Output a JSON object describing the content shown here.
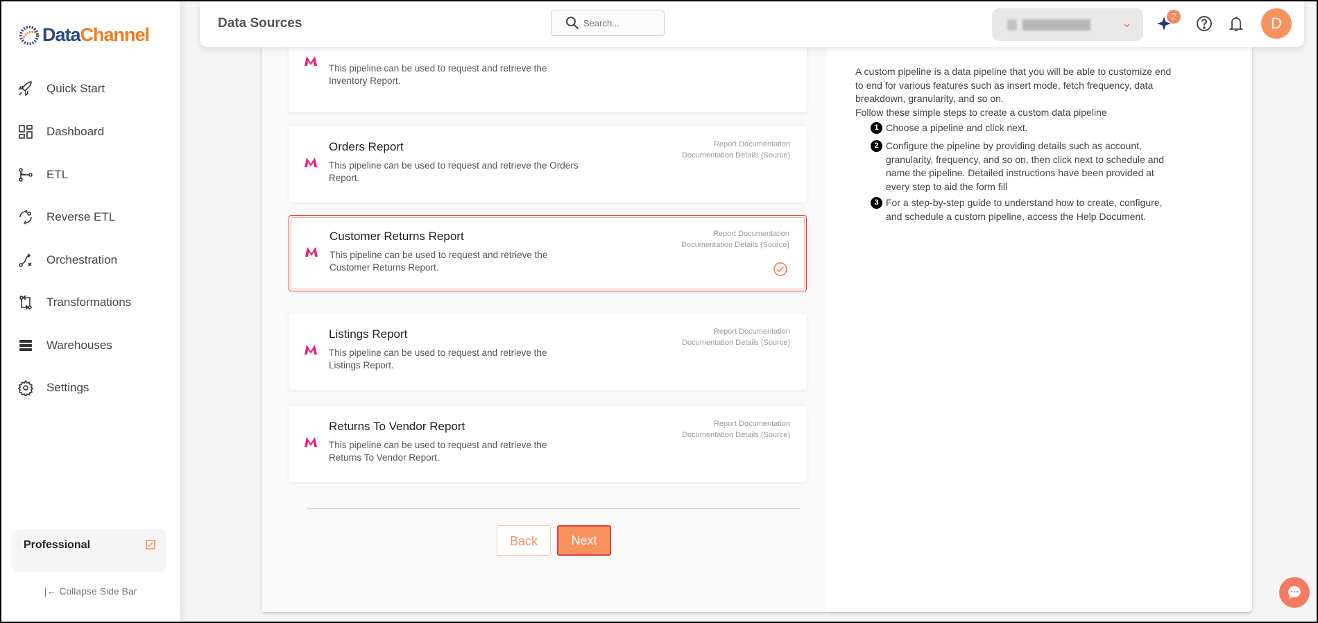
{
  "brand": {
    "name_part1": "Data",
    "name_part2": "Channel",
    "colors": {
      "blue": "#2a4a7f",
      "orange": "#f47c20"
    }
  },
  "sidebar": {
    "items": [
      {
        "label": "Quick Start",
        "icon": "rocket-icon"
      },
      {
        "label": "Dashboard",
        "icon": "dashboard-icon"
      },
      {
        "label": "ETL",
        "icon": "etl-icon"
      },
      {
        "label": "Reverse ETL",
        "icon": "reverse-etl-icon"
      },
      {
        "label": "Orchestration",
        "icon": "orchestration-icon"
      },
      {
        "label": "Transformations",
        "icon": "transformations-icon"
      },
      {
        "label": "Warehouses",
        "icon": "warehouses-icon"
      },
      {
        "label": "Settings",
        "icon": "gear-icon"
      }
    ],
    "plan": "Professional",
    "collapse": "Collapse Side Bar"
  },
  "header": {
    "title": "Data Sources",
    "search_placeholder": "Search...",
    "notification_count": "2",
    "avatar_initial": "D"
  },
  "cards": [
    {
      "title": "",
      "description": "This pipeline can be used to request and retrieve the Inventory Report.",
      "selected": false
    },
    {
      "title": "Orders Report",
      "description": "This pipeline can be used to request and retrieve the Orders Report.",
      "doc1": "Report Documentation",
      "doc2": "Documentation Details (Source)",
      "selected": false
    },
    {
      "title": "Customer Returns Report",
      "description": "This pipeline can be used to request and retrieve the Customer Returns Report.",
      "doc1": "Report Documentation",
      "doc2": "Documentation Details (Source)",
      "selected": true
    },
    {
      "title": "Listings Report",
      "description": "This pipeline can be used to request and retrieve the Listings Report.",
      "doc1": "Report Documentation",
      "doc2": "Documentation Details (Source)",
      "selected": false
    },
    {
      "title": "Returns To Vendor Report",
      "description": "This pipeline can be used to request and retrieve the Returns To Vendor Report.",
      "doc1": "Report Documentation",
      "doc2": "Documentation Details (Source)",
      "selected": false
    }
  ],
  "buttons": {
    "back": "Back",
    "next": "Next"
  },
  "info": {
    "intro": "A custom pipeline is a data pipeline that you will be able to customize end to end for various features such as insert mode, fetch frequency, data breakdown, granularity, and so on.",
    "follow": "Follow these simple steps to create a custom data pipeline",
    "steps": [
      {
        "num": "1",
        "text": "Choose a pipeline and click next."
      },
      {
        "num": "2",
        "text": "Configure the pipeline by providing details such as account, granularity, frequency, and so on, then click next to schedule and name the pipeline. Detailed instructions have been provided at every step to aid the form fill"
      },
      {
        "num": "3",
        "text": "For a step-by-step guide to understand how to create, configure, and schedule a custom pipeline, access the Help Document."
      }
    ]
  },
  "accent": "#f7925f"
}
